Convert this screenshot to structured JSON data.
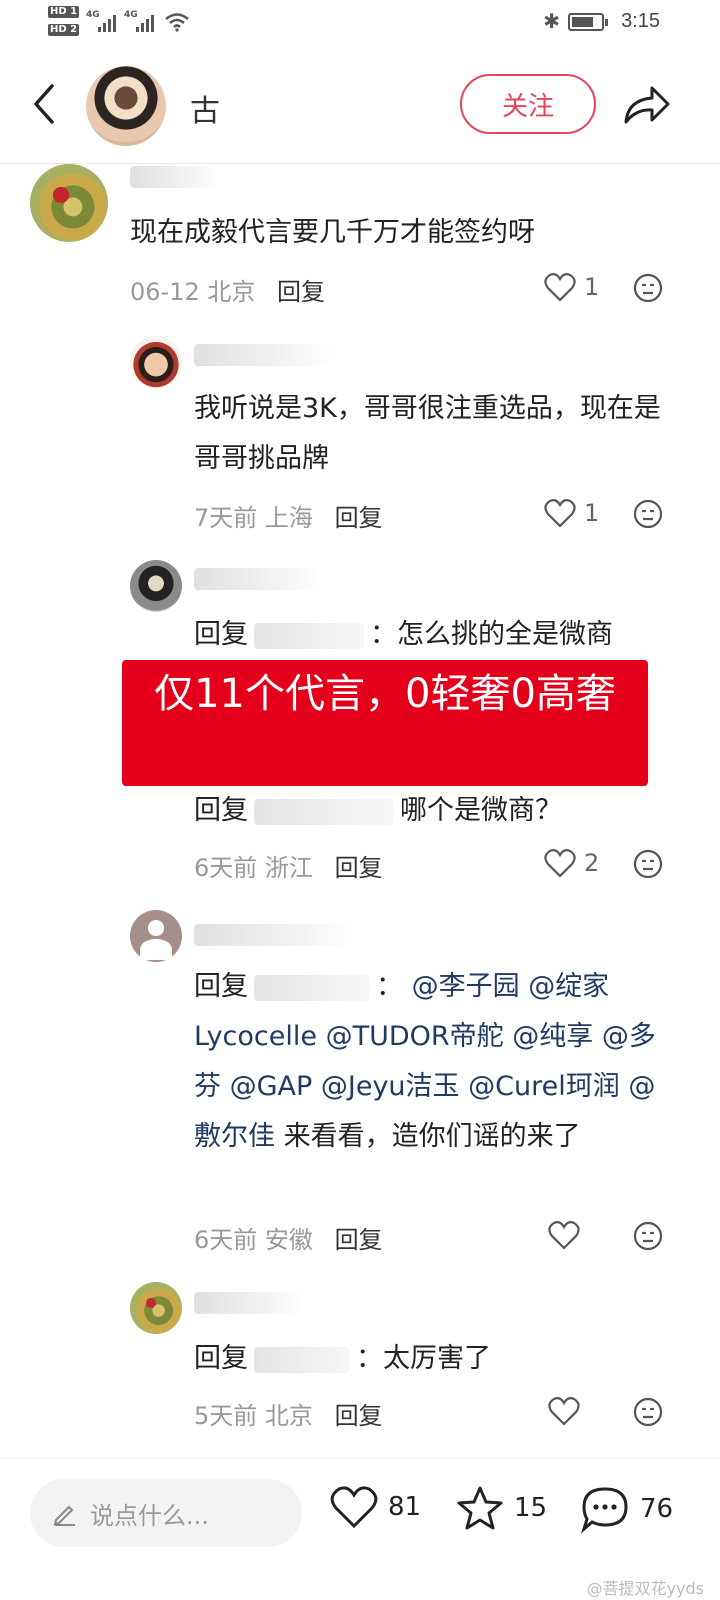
{
  "status_bar": {
    "hd1": "HD 1",
    "hd2": "HD 2",
    "net1": "4G",
    "net2": "4G",
    "time": "3:15",
    "battery_level": 0.75
  },
  "header": {
    "username": "古",
    "follow_label": "关注"
  },
  "comments": [
    {
      "text": "现在成毅代言要几千万才能签约呀",
      "date": "06-12",
      "location": "北京",
      "reply_label": "回复",
      "likes": "1"
    },
    {
      "text": "我听说是3K，哥哥很注重选品，现在是哥哥挑品牌",
      "date": "7天前",
      "location": "上海",
      "reply_label": "回复",
      "likes": "1"
    },
    {
      "reply_prefix": "回复",
      "text": "：怎么挑的全是微商"
    },
    {
      "reply_prefix": "回复",
      "text": "哪个是微商？",
      "date": "6天前",
      "location": "浙江",
      "reply_label": "回复",
      "likes": "2"
    },
    {
      "reply_prefix": "回复",
      "colon": "：",
      "mention1": "@李子园",
      "mention2": "@绽家Lycocelle",
      "mention3": "@TUDOR帝舵",
      "mention4": "@纯享",
      "mention5": "@多芬",
      "mention6": "@GAP",
      "mention7": "@Jeyu洁玉",
      "mention8": "@Curel珂润",
      "mention9": "@敷尔佳",
      "tail": "来看看，造你们谣的来了",
      "date": "6天前",
      "location": "安徽",
      "reply_label": "回复"
    },
    {
      "reply_prefix": "回复",
      "text": "：太厉害了",
      "date": "5天前",
      "location": "北京",
      "reply_label": "回复"
    }
  ],
  "banner": {
    "text": "仅11个代言，0轻奢0高奢"
  },
  "bottom_bar": {
    "placeholder": "说点什么...",
    "likes": "81",
    "stars": "15",
    "comments": "76",
    "watermark": "@菩提双花yyds"
  },
  "colors": {
    "accent": "#e3465a",
    "banner": "#e4001b",
    "mention": "#1f3b63"
  }
}
